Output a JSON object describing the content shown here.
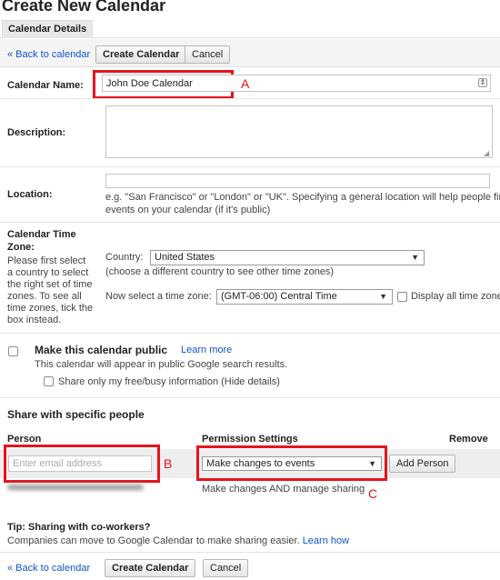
{
  "page": {
    "title": "Create New Calendar",
    "tab": "Calendar Details"
  },
  "toolbar_top": {
    "back_link": "« Back to calendar",
    "create_button": "Create Calendar",
    "cancel_button": "Cancel"
  },
  "calendar_name": {
    "label": "Calendar Name:",
    "value": "John Doe Calendar",
    "annotation": "A"
  },
  "description": {
    "label": "Description:",
    "value": ""
  },
  "location": {
    "label": "Location:",
    "value": "",
    "hint_line1": "e.g. \"San Francisco\" or \"London\" or \"UK\". Specifying a general location will help people find",
    "hint_line2": "events on your calendar (if it's public)"
  },
  "timezone": {
    "label_line1": "Calendar Time",
    "label_line2": "Zone:",
    "help_lines": [
      "Please first select",
      "a country to select",
      "the right set of time",
      "zones. To see all",
      "time zones, tick the",
      "box instead."
    ],
    "country_label": "Country:",
    "country_value": "United States",
    "country_hint": "(choose a different country to see other time zones)",
    "tz_label": "Now select a time zone:",
    "tz_value": "(GMT-06:00) Central Time",
    "display_all_label": "Display all time zones"
  },
  "public": {
    "title": "Make this calendar public",
    "learn_more": "Learn more",
    "hint": "This calendar will appear in public Google search results.",
    "freebusy_label": "Share only my free/busy information (Hide details)"
  },
  "share": {
    "heading": "Share with specific people",
    "col_person": "Person",
    "col_permission": "Permission Settings",
    "col_remove": "Remove",
    "email_placeholder": "Enter email address",
    "email_annotation": "B",
    "permission_value": "Make changes to events",
    "permission_annotation": "C",
    "add_person_button": "Add Person",
    "existing_permission": "Make changes AND manage sharing"
  },
  "tip": {
    "title": "Tip: Sharing with co-workers?",
    "text": "Companies can move to Google Calendar to make sharing easier.",
    "link": "Learn how"
  },
  "toolbar_bottom": {
    "back_link": "« Back to calendar",
    "create_button": "Create Calendar",
    "cancel_button": "Cancel"
  }
}
